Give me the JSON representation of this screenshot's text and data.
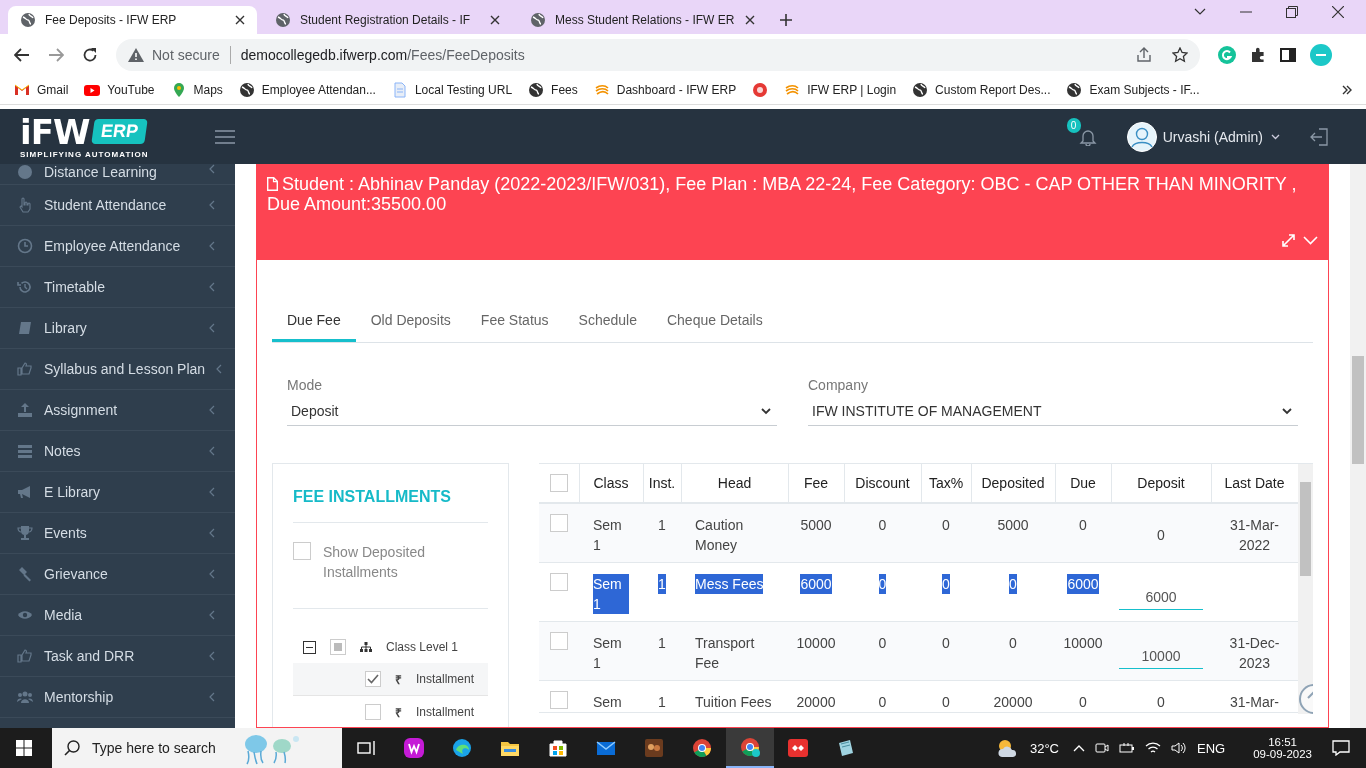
{
  "browser": {
    "tabs": [
      {
        "title": "Fee Deposits - IFW ERP",
        "selected": true
      },
      {
        "title": "Student Registration Details - IF",
        "selected": false
      },
      {
        "title": "Mess Student Relations - IFW ER",
        "selected": false
      }
    ],
    "security": "Not secure",
    "url_host": "democollegedb.ifwerp.com",
    "url_path": "/Fees/FeeDeposits",
    "bookmarks": [
      {
        "kind": "gmail",
        "label": "Gmail"
      },
      {
        "kind": "youtube",
        "label": "YouTube"
      },
      {
        "kind": "maps",
        "label": "Maps"
      },
      {
        "kind": "globe",
        "label": "Employee Attendan..."
      },
      {
        "kind": "page",
        "label": "Local Testing URL"
      },
      {
        "kind": "globe",
        "label": "Fees"
      },
      {
        "kind": "ifw",
        "label": "Dashboard - IFW ERP"
      },
      {
        "kind": "dot"
      },
      {
        "kind": "ifw",
        "label": "IFW ERP | Login"
      },
      {
        "kind": "globe",
        "label": "Custom Report Des..."
      },
      {
        "kind": "globe",
        "label": "Exam Subjects - IF..."
      }
    ]
  },
  "app": {
    "logo": {
      "name": "iFW",
      "badge": "ERP",
      "tagline": "SIMPLIFYING AUTOMATION"
    },
    "notifications": "0",
    "user": "Urvashi (Admin)"
  },
  "sidebar": {
    "items": [
      {
        "label": "Distance Learning"
      },
      {
        "label": "Student Attendance"
      },
      {
        "label": "Employee Attendance"
      },
      {
        "label": "Timetable"
      },
      {
        "label": "Library"
      },
      {
        "label": "Syllabus and Lesson Plan"
      },
      {
        "label": "Assignment"
      },
      {
        "label": "Notes"
      },
      {
        "label": "E Library"
      },
      {
        "label": "Events"
      },
      {
        "label": "Grievance"
      },
      {
        "label": "Media"
      },
      {
        "label": "Task and DRR"
      },
      {
        "label": "Mentorship"
      }
    ]
  },
  "fee_header": {
    "text": "Student : Abhinav Panday (2022-2023/IFW/031), Fee Plan : MBA 22-24, Fee Category: OBC - CAP OTHER THAN MINORITY , Due Amount:35500.00"
  },
  "tabs": [
    {
      "label": "Due Fee",
      "selected": true
    },
    {
      "label": "Old Deposits",
      "selected": false
    },
    {
      "label": "Fee Status",
      "selected": false
    },
    {
      "label": "Schedule",
      "selected": false
    },
    {
      "label": "Cheque Details",
      "selected": false
    }
  ],
  "mode": {
    "label": "Mode",
    "value": "Deposit"
  },
  "company": {
    "label": "Company",
    "value": "IFW INSTITUTE OF MANAGEMENT"
  },
  "installments": {
    "title": "FEE INSTALLMENTS",
    "show_deposited": {
      "label": "Show Deposited Installments",
      "checked": false
    },
    "tree": [
      {
        "label": "Class Level 1",
        "expanded": true,
        "checked": false,
        "indeterminate": true,
        "children": [
          {
            "currency": "₹",
            "label": "Installment",
            "checked": true,
            "selected": true
          },
          {
            "currency": "₹",
            "label": "Installment",
            "checked": false,
            "selected": false
          }
        ]
      }
    ]
  },
  "table": {
    "select_all_checked": false,
    "columns": [
      "Class",
      "Inst.",
      "Head",
      "Fee",
      "Discount",
      "Tax%",
      "Deposited",
      "Due",
      "Deposit",
      "Last Date"
    ],
    "rows": [
      {
        "checked": false,
        "text_selected": false,
        "class": "Sem 1",
        "inst": "1",
        "head": "Caution Money",
        "fee": "5000",
        "discount": "0",
        "tax": "0",
        "deposited": "5000",
        "due": "0",
        "deposit": "0",
        "deposit_editable": false,
        "last_date": "31-Mar-2022"
      },
      {
        "checked": false,
        "text_selected": true,
        "class": "Sem 1",
        "inst": "1",
        "head": "Mess Fees",
        "fee": "6000",
        "discount": "0",
        "tax": "0",
        "deposited": "0",
        "due": "6000",
        "deposit": "6000",
        "deposit_editable": true
      },
      {
        "checked": false,
        "text_selected": false,
        "class": "Sem 1",
        "inst": "1",
        "head": "Transport Fee",
        "fee": "10000",
        "discount": "0",
        "tax": "0",
        "deposited": "0",
        "due": "10000",
        "deposit": "10000",
        "deposit_editable": true,
        "last_date": "31-Dec-2023"
      },
      {
        "checked": false,
        "text_selected": false,
        "class": "Sem",
        "inst": "1",
        "head": "Tuition Fees",
        "fee": "20000",
        "discount": "0",
        "tax": "0",
        "deposited": "20000",
        "due": "0",
        "deposit": "0",
        "deposit_editable": false,
        "last_date": "31-Mar-"
      }
    ]
  },
  "taskbar": {
    "search_placeholder": "Type here to search",
    "temperature": "32°C",
    "language": "ENG",
    "time": "16:51",
    "date": "09-09-2023"
  }
}
